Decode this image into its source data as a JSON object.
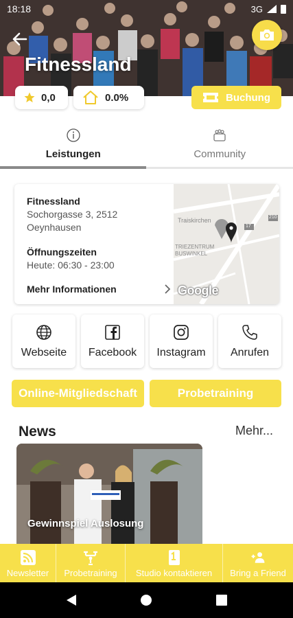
{
  "status_bar": {
    "time": "18:18",
    "network": "3G"
  },
  "header": {
    "studio_name": "Fitnessland",
    "rating": "0,0",
    "house_percent": "0.0%",
    "booking_label": "Buchung",
    "colors": {
      "accent": "#f7e04b"
    }
  },
  "tabs": [
    {
      "label": "Leistungen",
      "icon": "info-icon",
      "active": true
    },
    {
      "label": "Community",
      "icon": "group-icon",
      "active": false
    }
  ],
  "info_card": {
    "name": "Fitnessland",
    "address_line1": "Sochorgasse 3, 2512",
    "address_line2": "Oeynhausen",
    "hours_label": "Öffnungszeiten",
    "hours_today": "Heute: 06:30 - 23:00",
    "more_info": "Mehr Informationen",
    "map": {
      "labels": [
        "Traiskirchen",
        "TRIEZENTRUM",
        "BUSWINKEL",
        "17",
        "210"
      ],
      "google": "Google"
    }
  },
  "social": [
    {
      "label": "Webseite",
      "icon": "globe-icon"
    },
    {
      "label": "Facebook",
      "icon": "facebook-icon"
    },
    {
      "label": "Instagram",
      "icon": "instagram-icon"
    },
    {
      "label": "Anrufen",
      "icon": "phone-icon"
    }
  ],
  "cta": {
    "membership": "Online-Mitgliedschaft",
    "trial": "Probetraining"
  },
  "news": {
    "title": "News",
    "more": "Mehr...",
    "items": [
      {
        "title": "Gewinnspiel Auslosung"
      }
    ]
  },
  "bottom_nav": [
    {
      "label": "Newsletter",
      "icon": "rss-icon"
    },
    {
      "label": "Probetraining",
      "icon": "dumbbell-icon"
    },
    {
      "label": "Studio kontaktieren",
      "icon": "contact-icon"
    },
    {
      "label": "Bring a Friend",
      "icon": "add-friend-icon"
    }
  ]
}
